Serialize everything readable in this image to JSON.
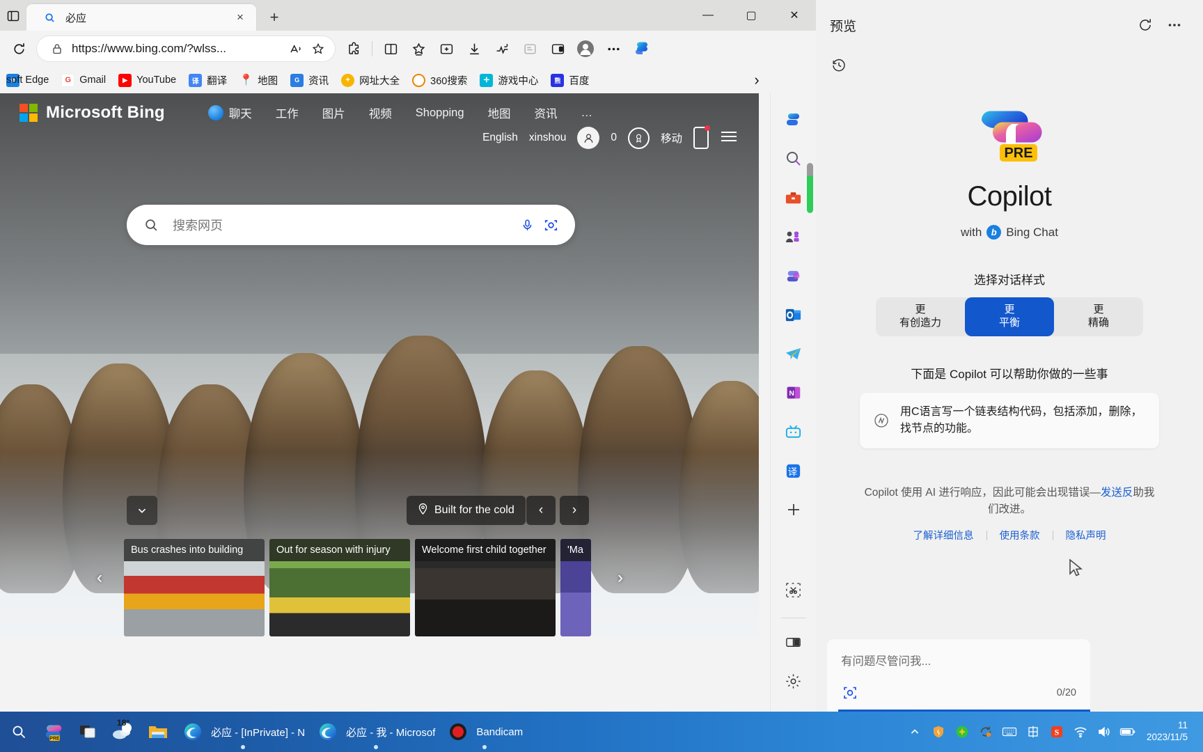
{
  "browser": {
    "tab": {
      "title": "必应",
      "favicon": "search-icon",
      "close": "×"
    },
    "new_tab": "+",
    "window_controls": {
      "minimize": "—",
      "maximize": "▢",
      "close": "✕"
    },
    "address": {
      "url": "https://www.bing.com/?wlss...",
      "lock_icon": "lock-icon",
      "read_aloud_icon": "read-aloud-icon",
      "favorite_icon": "star-icon"
    },
    "toolbar_icons": [
      "extensions-icon",
      "split-screen-icon",
      "collections-icon",
      "browser-essentials-icon",
      "downloads-icon",
      "performance-icon",
      "read-aloud-disabled-icon",
      "screen-cast-icon",
      "profile-icon",
      "settings-more-icon",
      "copilot-icon"
    ],
    "bookmarks": [
      {
        "label": "soft Edge",
        "icon": "edge-icon",
        "color": "#1a7fe0"
      },
      {
        "label": "Gmail",
        "icon": "gmail-icon",
        "color": "#ea4335"
      },
      {
        "label": "YouTube",
        "icon": "youtube-icon",
        "color": "#ff0000"
      },
      {
        "label": "翻译",
        "icon": "translate-icon",
        "color": "#4285f4"
      },
      {
        "label": "地图",
        "icon": "maps-icon",
        "color": "#34a853"
      },
      {
        "label": "资讯",
        "icon": "news-icon",
        "color": "#2a7de1"
      },
      {
        "label": "网址大全",
        "icon": "hao123-icon",
        "color": "#f7b500"
      },
      {
        "label": "360搜索",
        "icon": "360-icon",
        "color": "#f08300"
      },
      {
        "label": "游戏中心",
        "icon": "game-center-icon",
        "color": "#00b6d8"
      },
      {
        "label": "百度",
        "icon": "baidu-icon",
        "color": "#2932e1"
      }
    ],
    "bookmarks_overflow": "›"
  },
  "bing": {
    "wordmark": "Microsoft Bing",
    "nav": [
      {
        "label": "聊天",
        "icon": "chat-bubble-icon"
      },
      {
        "label": "工作",
        "icon": ""
      },
      {
        "label": "图片",
        "icon": ""
      },
      {
        "label": "视频",
        "icon": ""
      },
      {
        "label": "Shopping",
        "icon": ""
      },
      {
        "label": "地图",
        "icon": ""
      },
      {
        "label": "资讯",
        "icon": ""
      },
      {
        "label": "…",
        "icon": "more-icon"
      }
    ],
    "account_row": {
      "language": "English",
      "username": "xinshou",
      "rewards_points": "0",
      "rewards_icon": "rewards-medal-icon",
      "mobile_label": "移动",
      "hamburger_icon": "hamburger-icon"
    },
    "search": {
      "placeholder": "搜索网页",
      "mic_icon": "microphone-icon",
      "camera_icon": "visual-search-icon"
    },
    "image_badge": {
      "label": "Built for the cold",
      "pin_icon": "location-pin-icon"
    },
    "image_prev": "‹",
    "image_next": "›",
    "collapse_icon": "chevron-down-icon",
    "news_prev": "‹",
    "news_next": "›",
    "news_cards": [
      {
        "title": "Bus crashes into building"
      },
      {
        "title": "Out for season with injury"
      },
      {
        "title": "Welcome first child together"
      },
      {
        "title": "'Ma"
      }
    ]
  },
  "sidebar_rail": [
    {
      "name": "copilot-icon"
    },
    {
      "name": "search-icon"
    },
    {
      "name": "tools-icon"
    },
    {
      "name": "games-icon"
    },
    {
      "name": "office-icon"
    },
    {
      "name": "outlook-icon"
    },
    {
      "name": "telegram-icon"
    },
    {
      "name": "onenote-icon"
    },
    {
      "name": "bilibili-icon"
    },
    {
      "name": "translate-icon"
    },
    {
      "name": "add-icon"
    },
    {
      "name": "screenshot-icon"
    },
    {
      "name": "split-view-icon"
    },
    {
      "name": "settings-gear-icon"
    }
  ],
  "copilot": {
    "header_title": "预览",
    "refresh_icon": "refresh-icon",
    "more_icon": "more-options-icon",
    "history_icon": "history-icon",
    "logo_badge": "PRE",
    "name": "Copilot",
    "with_text_prefix": "with",
    "with_text_suffix": "Bing Chat",
    "bing_mark": "b",
    "style_label": "选择对话样式",
    "styles": [
      {
        "line1": "更",
        "line2": "有创造力",
        "active": false
      },
      {
        "line1": "更",
        "line2": "平衡",
        "active": true
      },
      {
        "line1": "更",
        "line2": "精确",
        "active": false
      }
    ],
    "suggest_label": "下面是 Copilot 可以帮助你做的一些事",
    "suggest_card": {
      "icon": "sparkle-code-icon",
      "text": "用C语言写一个链表结构代码，包括添加，删除，找节点的功能。"
    },
    "disclaimer_prefix": "Copilot 使用 AI 进行响应，因此可能会出现错误—",
    "disclaimer_link": "发送反",
    "disclaimer_suffix": "助我们改进。",
    "links": [
      {
        "label": "了解详细信息"
      },
      {
        "label": "使用条款"
      },
      {
        "label": "隐私声明"
      }
    ],
    "cursor_icon": "mouse-cursor-icon",
    "input": {
      "placeholder": "有问题尽管问我...",
      "camera_icon": "visual-search-icon",
      "counter": "0/20"
    },
    "accent_color": "#1257cc"
  },
  "taskbar": {
    "items": [
      {
        "label": "",
        "icon": "search-icon",
        "active": false
      },
      {
        "label": "",
        "icon": "copilot-pre-icon",
        "active": false
      },
      {
        "label": "",
        "icon": "task-view-icon",
        "active": false
      },
      {
        "label": "18°",
        "icon": "weather-icon",
        "active": false
      },
      {
        "label": "",
        "icon": "file-explorer-icon",
        "active": false
      },
      {
        "label": "必应 - [InPrivate] - N",
        "icon": "edge-icon",
        "active": true
      },
      {
        "label": "必应 - 我 - Microsof",
        "icon": "edge-icon",
        "active": true
      },
      {
        "label": "Bandicam",
        "icon": "bandicam-icon",
        "active": true
      }
    ],
    "tray": [
      {
        "name": "show-hidden-icons-chevron"
      },
      {
        "name": "shield-security-icon"
      },
      {
        "name": "green-antivirus-icon"
      },
      {
        "name": "update-sync-icon"
      },
      {
        "name": "keyboard-icon"
      },
      {
        "name": "ime-chinese-icon"
      },
      {
        "name": "sogou-icon"
      },
      {
        "name": "wifi-icon"
      },
      {
        "name": "volume-icon"
      },
      {
        "name": "battery-icon"
      }
    ],
    "clock": {
      "time": "11",
      "date": "2023/11/5"
    }
  }
}
